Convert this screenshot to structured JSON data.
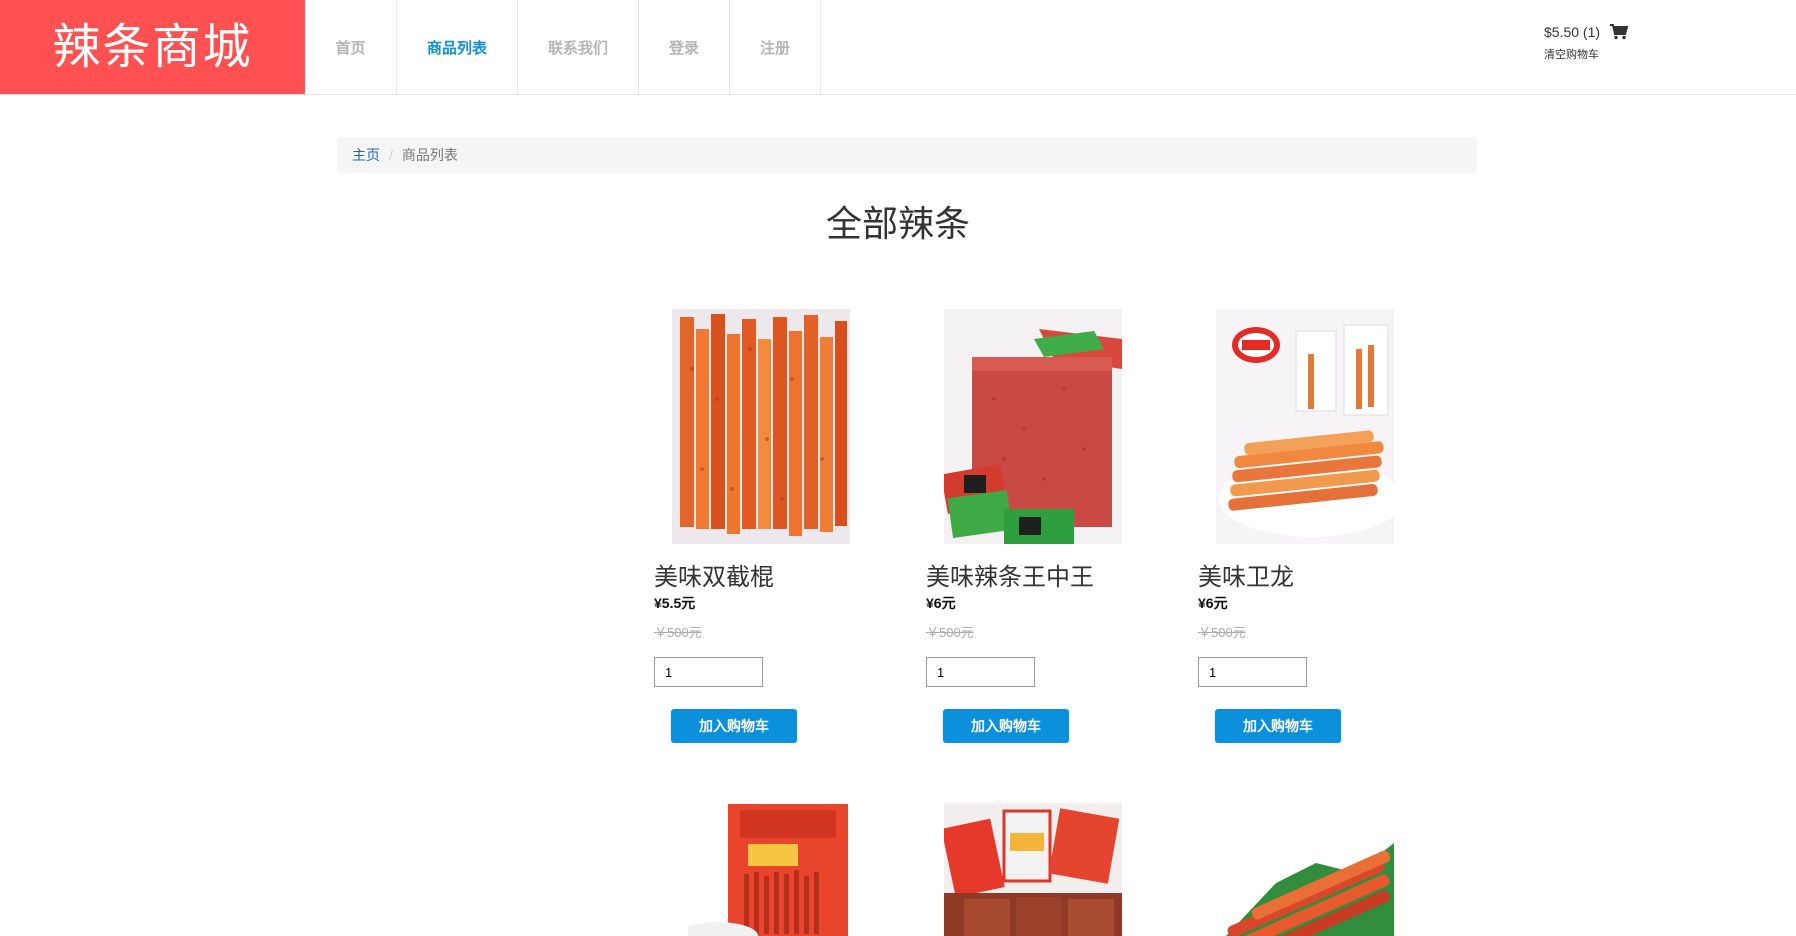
{
  "brand": {
    "logo_text": "辣条商城"
  },
  "nav": {
    "items": [
      {
        "label": "首页"
      },
      {
        "label": "商品列表"
      },
      {
        "label": "联系我们"
      },
      {
        "label": "登录"
      },
      {
        "label": "注册"
      }
    ]
  },
  "cart": {
    "total": "$5.50 (1)",
    "clear_label": "清空购物车"
  },
  "breadcrumb": {
    "home": "主页",
    "sep": "/",
    "current": "商品列表"
  },
  "page": {
    "heading": "全部辣条"
  },
  "products": [
    {
      "name": "美味双截棍",
      "price": "¥5.5元",
      "old_price": "￥500元",
      "qty": "1",
      "add_label": "加入购物车"
    },
    {
      "name": "美味辣条王中王",
      "price": "¥6元",
      "old_price": "￥500元",
      "qty": "1",
      "add_label": "加入购物车"
    },
    {
      "name": "美味卫龙",
      "price": "¥6元",
      "old_price": "￥500元",
      "qty": "1",
      "add_label": "加入购物车"
    }
  ],
  "colors": {
    "brand": "#ff5151",
    "accent": "#0b91db",
    "nav_active": "#0f8fd8"
  },
  "icons": {
    "cart": "shopping-cart-icon"
  }
}
